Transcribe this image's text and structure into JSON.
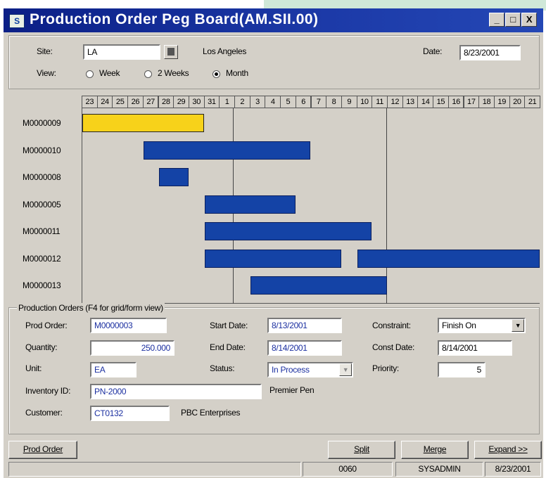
{
  "window": {
    "title": "Production Order Peg Board(AM.SII.00)",
    "icon_glyph": "S",
    "controls": [
      "_",
      "□",
      "X"
    ]
  },
  "header": {
    "site_label": "Site:",
    "site_value": "LA",
    "site_name": "Los Angeles",
    "date_label": "Date:",
    "date_value": "8/23/2001",
    "view_label": "View:",
    "view_options": [
      {
        "label": "Week",
        "selected": false
      },
      {
        "label": "2 Weeks",
        "selected": false
      },
      {
        "label": "Month",
        "selected": true
      }
    ]
  },
  "gantt": {
    "days": [
      "23",
      "24",
      "25",
      "26",
      "27",
      "28",
      "29",
      "30",
      "31",
      "1",
      "2",
      "3",
      "4",
      "5",
      "6",
      "7",
      "8",
      "9",
      "10",
      "11",
      "12",
      "13",
      "14",
      "15",
      "16",
      "17",
      "18",
      "19",
      "20",
      "21"
    ],
    "orders": [
      {
        "id": "M0000009",
        "bars": [
          {
            "start": 0,
            "end": 8,
            "selected": true
          }
        ]
      },
      {
        "id": "M0000010",
        "bars": [
          {
            "start": 4,
            "end": 15
          }
        ]
      },
      {
        "id": "M0000008",
        "bars": [
          {
            "start": 5,
            "end": 7
          }
        ]
      },
      {
        "id": "M0000005",
        "bars": [
          {
            "start": 8,
            "end": 14
          }
        ]
      },
      {
        "id": "M0000011",
        "bars": [
          {
            "start": 8,
            "end": 19
          }
        ]
      },
      {
        "id": "M0000012",
        "bars": [
          {
            "start": 8,
            "end": 17
          },
          {
            "start": 18,
            "end": 30
          }
        ]
      },
      {
        "id": "M0000013",
        "bars": [
          {
            "start": 11,
            "end": 20
          }
        ]
      }
    ],
    "colors": {
      "bar": "#1443a6",
      "selected": "#f7d21a"
    }
  },
  "details": {
    "group_label": "Production Orders (F4 for grid/form view)",
    "prod_order_label": "Prod Order:",
    "prod_order_value": "M0000003",
    "quantity_label": "Quantity:",
    "quantity_value": "250.000",
    "unit_label": "Unit:",
    "unit_value": "EA",
    "inventory_label": "Inventory ID:",
    "inventory_value": "PN-2000",
    "inventory_desc": "Premier Pen",
    "customer_label": "Customer:",
    "customer_value": "CT0132",
    "customer_name": "PBC Enterprises",
    "start_label": "Start Date:",
    "start_value": "8/13/2001",
    "end_label": "End Date:",
    "end_value": "8/14/2001",
    "status_label": "Status:",
    "status_value": "In Process",
    "constraint_label": "Constraint:",
    "constraint_value": "Finish On",
    "const_date_label": "Const Date:",
    "const_date_value": "8/14/2001",
    "priority_label": "Priority:",
    "priority_value": "5"
  },
  "buttons": {
    "prod_order": "Prod Order",
    "split": "Split",
    "merge": "Merge",
    "expand": "Expand >>"
  },
  "statusbar": {
    "field1": "",
    "company": "0060",
    "user": "SYSADMIN",
    "date": "8/23/2001"
  }
}
